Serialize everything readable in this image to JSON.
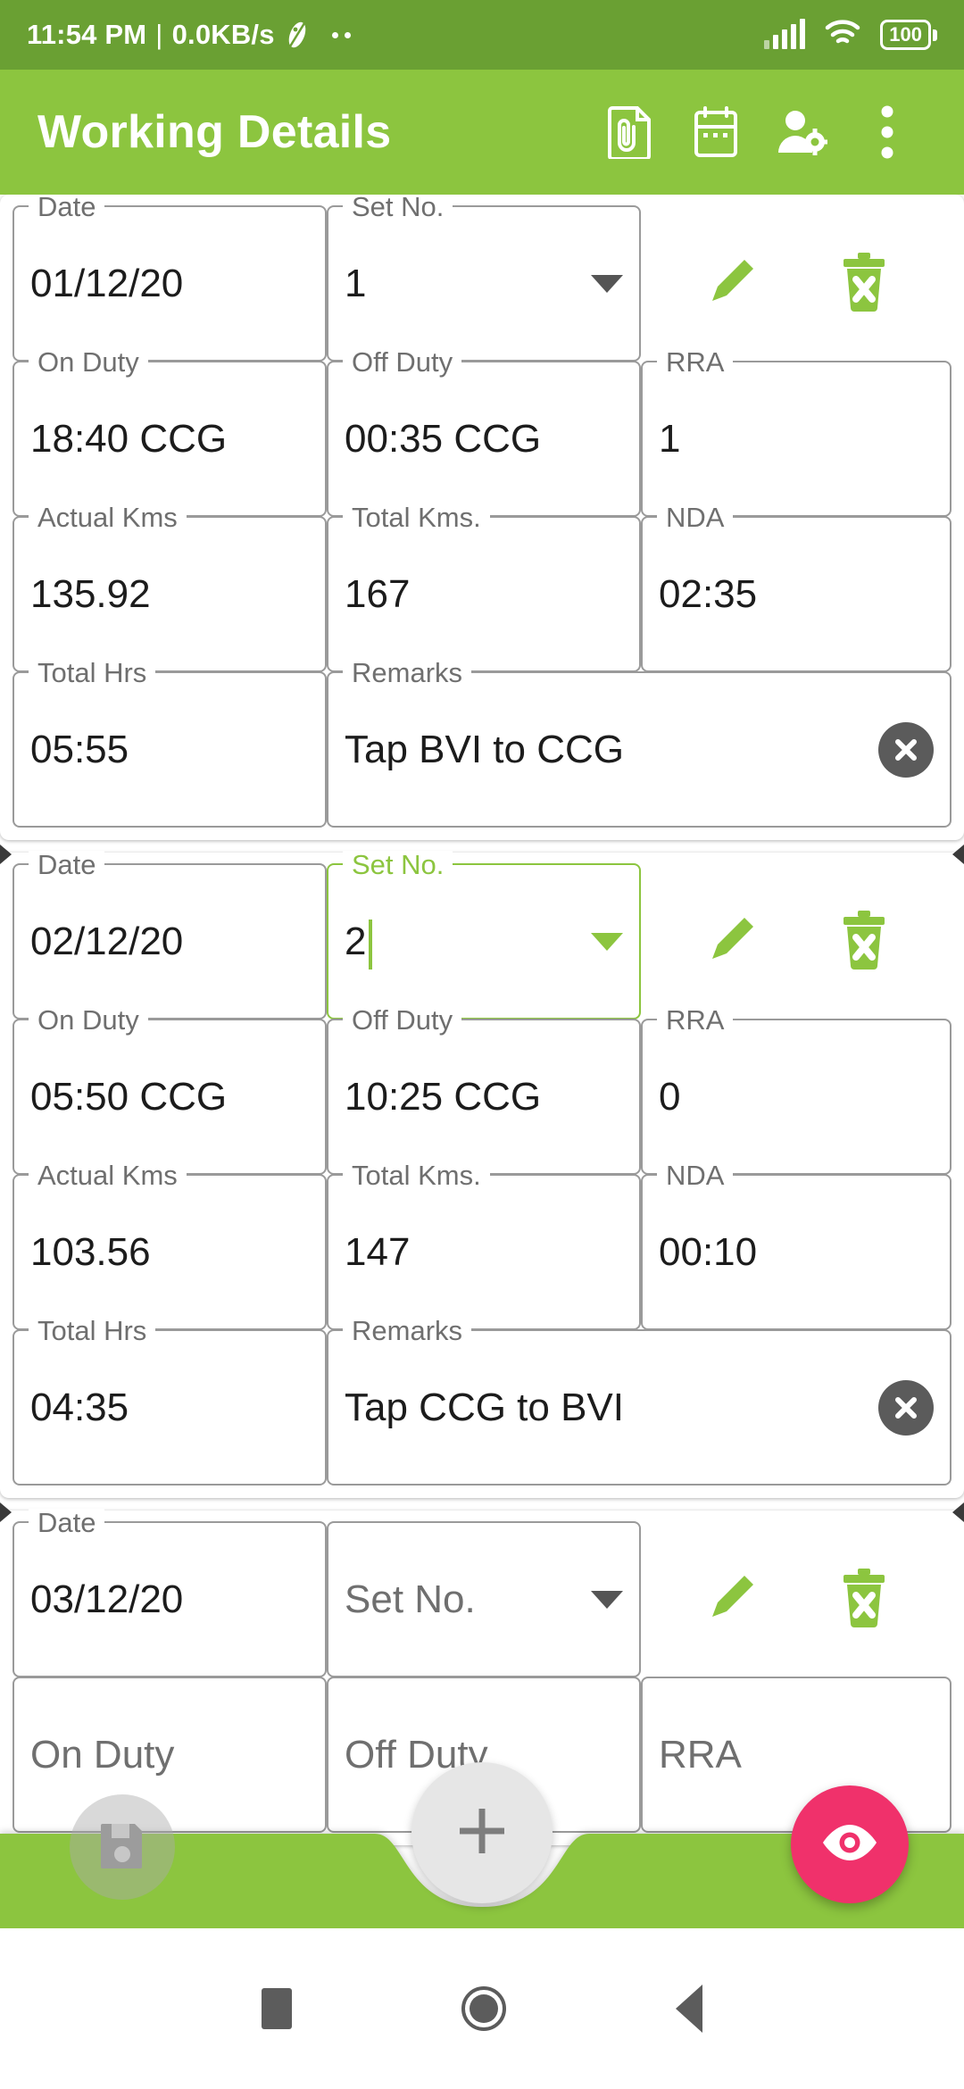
{
  "status_bar": {
    "time": "11:54 PM",
    "separator": "|",
    "network_speed": "0.0KB/s",
    "dna_icon": "dna-icon",
    "more_dots_icon": "more-dots-icon",
    "signal_icon": "signal-bars-icon",
    "wifi_icon": "wifi-icon",
    "battery_level": "100",
    "battery_icon": "battery-icon",
    "background_color": "#6aa033"
  },
  "app_bar": {
    "title": "Working Details",
    "background_color": "#8cc53f",
    "actions": [
      {
        "name": "attachment-document-icon",
        "label": "Attach Document"
      },
      {
        "name": "calendar-icon",
        "label": "Calendar"
      },
      {
        "name": "user-settings-icon",
        "label": "User Settings"
      },
      {
        "name": "overflow-menu-icon",
        "label": "More options"
      }
    ]
  },
  "theme": {
    "accent_green": "#8cc53f",
    "status_green": "#6aa033",
    "pink_fab": "#f0316b",
    "field_border": "#9a9a9a",
    "label_gray": "#6f6f6f",
    "value_black": "#1c1c1c",
    "clear_button_gray": "#5b5b5b"
  },
  "labels": {
    "date": "Date",
    "set_no": "Set No.",
    "on_duty": "On Duty",
    "off_duty": "Off Duty",
    "rra": "RRA",
    "actual_kms": "Actual Kms",
    "total_kms": "Total Kms.",
    "nda": "NDA",
    "total_hrs": "Total Hrs",
    "remarks": "Remarks"
  },
  "entries": [
    {
      "date": "01/12/20",
      "set_no": "1",
      "set_no_focused": false,
      "on_duty": "18:40 CCG",
      "off_duty": "00:35 CCG",
      "rra": "1",
      "actual_kms": "135.92",
      "total_kms": "167",
      "nda": "02:35",
      "total_hrs": "05:55",
      "remarks": "Tap BVI to CCG",
      "edit_icon": "edit-pencil-icon",
      "delete_icon": "delete-trash-icon",
      "clear_icon": "clear-x-icon"
    },
    {
      "date": "02/12/20",
      "set_no": "2",
      "set_no_focused": true,
      "on_duty": "05:50 CCG",
      "off_duty": "10:25 CCG",
      "rra": "0",
      "actual_kms": "103.56",
      "total_kms": "147",
      "nda": "00:10",
      "total_hrs": "04:35",
      "remarks": "Tap CCG to BVI",
      "edit_icon": "edit-pencil-icon",
      "delete_icon": "delete-trash-icon",
      "clear_icon": "clear-x-icon"
    },
    {
      "date": "03/12/20",
      "set_no": "",
      "set_no_placeholder": "Set No.",
      "set_no_focused": false,
      "on_duty": "",
      "on_duty_placeholder": "On Duty",
      "off_duty": "",
      "off_duty_placeholder": "Off Duty",
      "rra": "",
      "rra_placeholder": "RRA",
      "edit_icon": "edit-pencil-icon",
      "delete_icon": "delete-trash-icon"
    }
  ],
  "bottom_bar": {
    "background_color": "#8cc53f",
    "save_button": {
      "name": "save-icon",
      "label": "Save"
    },
    "add_button": {
      "name": "add-plus-icon",
      "label": "Add"
    },
    "view_button": {
      "name": "eye-view-icon",
      "label": "View"
    }
  },
  "nav_bar": {
    "recents": "recents-square-icon",
    "home": "home-circle-icon",
    "back": "back-triangle-icon"
  }
}
